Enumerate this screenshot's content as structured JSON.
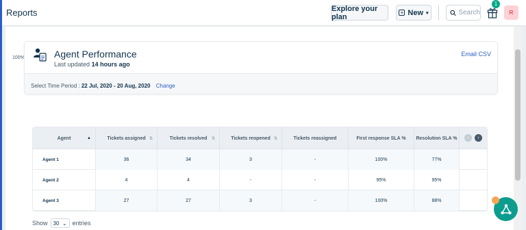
{
  "header": {
    "title": "Reports",
    "explore_label": "Explore your plan",
    "new_label": "New",
    "search_placeholder": "Search",
    "notification_count": "1",
    "avatar_initial": "R"
  },
  "zoom": "100%",
  "report": {
    "title": "Agent Performance",
    "updated_prefix": "Last updated",
    "updated_value": "14 hours ago",
    "email_csv": "Email CSV",
    "period_label": "Select Time Period :",
    "period_value": "22 Jul, 2020 - 20 Aug, 2020",
    "change_label": "Change"
  },
  "table": {
    "columns": [
      "Agent",
      "Tickets assigned",
      "Tickets resolved",
      "Tickets reopened",
      "Tickets reassigned",
      "First response SLA %",
      "Resolution SLA %"
    ],
    "rows": [
      [
        "Agent 1",
        "36",
        "34",
        "3",
        "-",
        "100%",
        "77%"
      ],
      [
        "Agent 2",
        "4",
        "4",
        "-",
        "-",
        "95%",
        "95%"
      ],
      [
        "Agent 3",
        "27",
        "27",
        "3",
        "-",
        "100%",
        "88%"
      ]
    ]
  },
  "pagination": {
    "show_label": "Show",
    "page_size": "30",
    "entries_label": "entries"
  },
  "colors": {
    "accent": "#2c5cc5",
    "badge": "#00a886",
    "fab": "#0d9d8e"
  }
}
